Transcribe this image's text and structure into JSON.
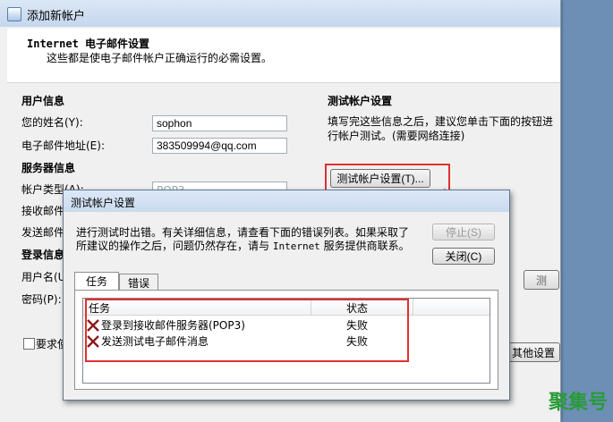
{
  "window": {
    "title": "添加新帐户",
    "header_title_latin": "Internet",
    "header_title_cn": "电子邮件设置",
    "header_subtitle": "这些都是使电子邮件帐户正确运行的必需设置。"
  },
  "form": {
    "user_info_heading": "用户信息",
    "name_label": "您的姓名(Y):",
    "name_value": "sophon",
    "email_label": "电子邮件地址(E):",
    "email_value": "383509994@qq.com",
    "server_info_heading": "服务器信息",
    "account_type_label": "帐户类型(A):",
    "account_type_value": "POP3",
    "incoming_label_partial": "接收邮件",
    "outgoing_label_partial": "发送邮件",
    "login_heading_partial": "登录信息",
    "username_label_partial": "用户名(U",
    "password_label": "密码(P):",
    "require_label_partial": "要求使"
  },
  "test_section": {
    "heading": "测试帐户设置",
    "description": "填写完这些信息之后，建议您单击下面的按钮进行帐户测试。(需要网络连接)",
    "test_button": "测试帐户设置(T)...",
    "partial_test_button": "测",
    "more_settings_button": "其他设置"
  },
  "dialog": {
    "title": "测试帐户设置",
    "message_line1": "进行测试时出错。有关详细信息，请查看下面的错误列表。如果采取了",
    "message_line2_a": "所建议的操作之后，问题仍然存在，请与 ",
    "message_line2_latin": "Internet",
    "message_line2_b": " 服务提供商联系。",
    "stop_button": "停止(S)",
    "close_button": "关闭(C)",
    "tabs": [
      "任务",
      "错误"
    ],
    "columns": {
      "task": "任务",
      "status": "状态"
    },
    "rows": [
      {
        "task": "登录到接收邮件服务器(POP3)",
        "status": "失败"
      },
      {
        "task": "发送测试电子邮件消息",
        "status": "失败"
      }
    ]
  },
  "watermark": "聚集号",
  "colors": {
    "annotation_red": "#e03030",
    "watermark_green": "#2a9a38"
  }
}
